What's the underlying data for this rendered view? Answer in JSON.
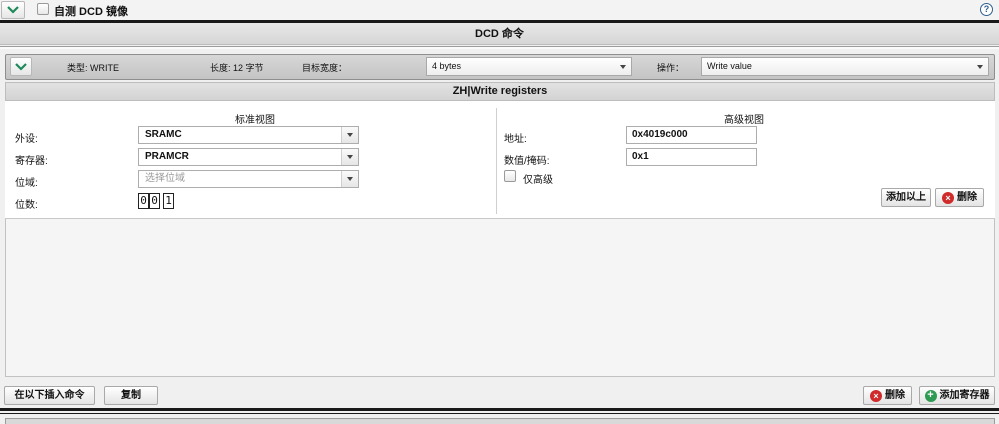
{
  "top": {
    "mirror_checkbox_label": "自测 DCD 镜像",
    "help_glyph": "?"
  },
  "dcd_header": "DCD 命令",
  "command_row": {
    "type_label": "类型: WRITE",
    "length_label": "长度: 12 字节",
    "target_width_label": "目标宽度：",
    "target_width_value": "4 bytes",
    "operation_label": "操作：",
    "operation_value": "Write value"
  },
  "section_title": "ZH|Write registers",
  "standard_view": {
    "title": "标准视图",
    "peripheral_label": "外设:",
    "peripheral_value": "SRAMC",
    "register_label": "寄存器:",
    "register_value": "PRAMCR",
    "bitfield_label": "位域:",
    "bitfield_placeholder": "选择位域",
    "bits_label": "位数:",
    "bits_digits": [
      "0",
      "0",
      "1"
    ]
  },
  "advanced_view": {
    "title": "高级视图",
    "address_label": "地址:",
    "address_value": "0x4019c000",
    "value_mask_label": "数值/掩码:",
    "value_mask_value": "0x1",
    "advanced_only_label": "仅高级",
    "add_above_button": "添加以上",
    "delete_button": "删除"
  },
  "bottom": {
    "insert_below_button": "在以下插入命令",
    "copy_button": "复制",
    "delete_button": "删除",
    "add_register_button": "添加寄存器"
  },
  "colors": {
    "accent_green": "#1e8a5a",
    "delete_red": "#d02a2a",
    "add_green": "#2f9a52"
  }
}
